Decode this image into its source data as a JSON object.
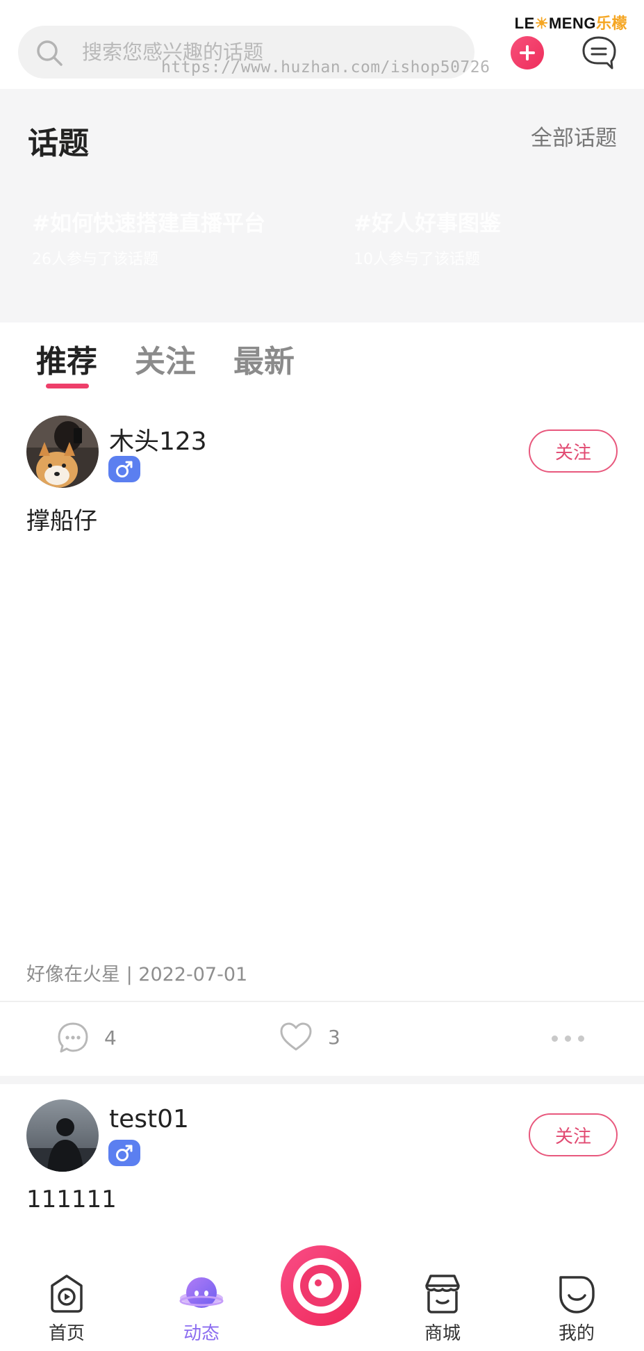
{
  "header": {
    "brand_latin_1": "LE",
    "brand_latin_2": "MENG",
    "brand_cn": "乐檬",
    "search_placeholder": "搜索您感兴趣的话题",
    "watermark": "https://www.huzhan.com/ishop50726"
  },
  "topics": {
    "title": "话题",
    "all_label": "全部话题",
    "items": [
      {
        "name": "#如何快速搭建直播平台",
        "count": "26人参与了该话题"
      },
      {
        "name": "#好人好事图鉴",
        "count": "10人参与了该话题"
      }
    ]
  },
  "feed_tabs": {
    "items": [
      "推荐",
      "关注",
      "最新"
    ],
    "active": "推荐"
  },
  "posts": [
    {
      "username": "木头123",
      "gender": "male",
      "follow_label": "关注",
      "content": "撑船仔",
      "meta": "好像在火星 | 2022-07-01",
      "comments": "4",
      "likes": "3"
    },
    {
      "username": "test01",
      "gender": "male",
      "follow_label": "关注",
      "content": "111111"
    }
  ],
  "tabbar": {
    "items": [
      {
        "label": "首页",
        "icon": "play-home-icon"
      },
      {
        "label": "动态",
        "icon": "planet-face-icon"
      },
      {
        "label": "",
        "icon": "camera-record-icon"
      },
      {
        "label": "商城",
        "icon": "store-icon"
      },
      {
        "label": "我的",
        "icon": "smile-profile-icon"
      }
    ],
    "active": "动态"
  },
  "colors": {
    "accent_pink": "#ee3f6a",
    "gender_blue": "#5b7ff0",
    "tab_active_purple": "#8b6cf0",
    "brand_orange": "#f5a623"
  }
}
